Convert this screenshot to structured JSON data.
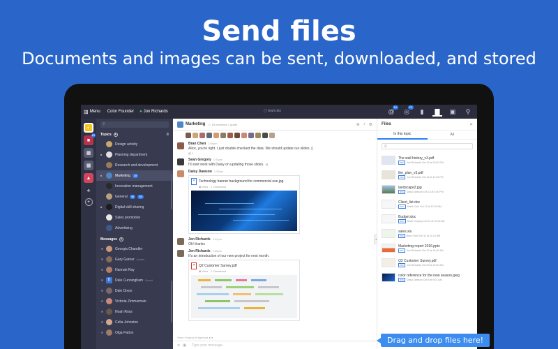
{
  "hero": {
    "title": "Send files",
    "subtitle": "Documents and images can be sent, downloaded, and stored"
  },
  "topbar": {
    "menu_label": "Menu",
    "team": "Color Founder",
    "user": "Jon Richards",
    "domain": "team.biz",
    "badge_1": "19",
    "badge_2": "22"
  },
  "rail": {
    "badge": "15"
  },
  "sidebar": {
    "topics_label": "Topics",
    "topics": [
      {
        "label": "Design activity"
      },
      {
        "label": "Planning department"
      },
      {
        "label": "Research and development"
      },
      {
        "label": "Marketing",
        "badge": "28"
      },
      {
        "label": "Innovation management"
      },
      {
        "label": "General",
        "badge": "38",
        "badge2": "55"
      },
      {
        "label": "Digital skill sharing"
      },
      {
        "label": "Sales promotion"
      },
      {
        "label": "Advertising"
      }
    ],
    "messages_label": "Messages",
    "messages": [
      {
        "label": "Georgia Chandler"
      },
      {
        "label": "Gary Garner",
        "tag": "Admin"
      },
      {
        "label": "Hannah Ray"
      },
      {
        "label": "Dale Cunningham",
        "tag": "Guest"
      },
      {
        "label": "Dale Dixon"
      },
      {
        "label": "Victoria Zimmerman"
      },
      {
        "label": "Noah Ross"
      },
      {
        "label": "Celia Johnston"
      },
      {
        "label": "Olga Patton"
      }
    ]
  },
  "chat": {
    "topic": "Marketing",
    "meta": "15 members 1 guest",
    "messages": [
      {
        "who": "Bran Chen",
        "time": "1:50pm",
        "text": "Alice, you're right. I just double-checked the data. We should update our slides.",
        "reaction": "1"
      },
      {
        "who": "Sean Gregory",
        "time": "1:53pm",
        "text": "I'll start work with Daisy on updating those slides."
      },
      {
        "who": "Daisy Dawson",
        "time": "1:55pm",
        "file": "Technology banner background for commercial use.jpg",
        "view": "View",
        "download": "Download"
      },
      {
        "who": "Jon Richards",
        "time": "2:02pm",
        "text": "Ok! thanks"
      },
      {
        "who": "Jon Richards",
        "time": "2:05pm",
        "text": "It's an introduction of our new project for next month.",
        "file": "Q2 Customer Survey.pdf",
        "view": "View",
        "download": "Download"
      }
    ],
    "typing": "Sean Gregory is typing",
    "composer_placeholder": "Type your message..."
  },
  "files": {
    "title": "Files",
    "tab_topic": "In this topic",
    "tab_all": "All",
    "items": [
      {
        "name": "The wall history_v3.pdf",
        "ext": "PDF",
        "meta": "Jon Richards Oct 16 at 10:00 PM"
      },
      {
        "name": "the_plan_v3.pdf",
        "ext": "PDF",
        "meta": "Jon Richards Oct 15 at 11:23 PM"
      },
      {
        "name": "landscape2.jpg",
        "ext": "JPG",
        "meta": "Daisy Dawson Oct 13 at 3:00 PM"
      },
      {
        "name": "Client_list.doc",
        "ext": "DOC",
        "meta": "Marie Cole Oct 12 at 12:02 AM"
      },
      {
        "name": "Budget.doc",
        "ext": "DOC",
        "meta": "Sean Gregory Oct 11 at 10:09 AM"
      },
      {
        "name": "sales.xls",
        "ext": "XLS",
        "meta": "Bran Chen Oct 11 at 11:13 AM"
      },
      {
        "name": "Marketing report 2016.pptx",
        "ext": "PPT",
        "meta": "Jon Richards Oct 10 at 10:40 AM"
      },
      {
        "name": "Q2 Customer Survey.pdf",
        "ext": "PDF",
        "meta": "Jon Richards Oct 09 at 10:00 AM"
      },
      {
        "name": "color reference for the new season.jpeg",
        "ext": "JPG",
        "meta": "Daisy Dawson Oct 8 at 9:01 AM"
      }
    ]
  },
  "callout": "Drag and drop files here!"
}
